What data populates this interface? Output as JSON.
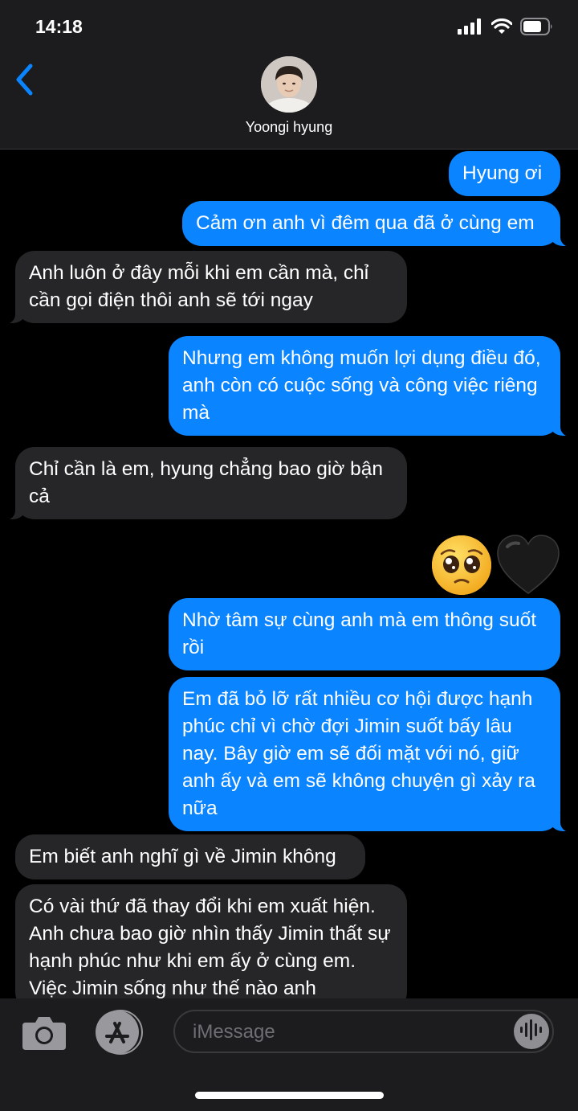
{
  "status_bar": {
    "time": "14:18"
  },
  "header": {
    "contact_name": "Yoongi hyung"
  },
  "messages": [
    {
      "sender": "me",
      "text": "Hyung ơi"
    },
    {
      "sender": "me",
      "text": "Cảm ơn anh vì đêm qua đã ở cùng em"
    },
    {
      "sender": "other",
      "text": "Anh luôn ở đây mỗi khi em cần mà, chỉ cần gọi điện thôi anh sẽ tới ngay"
    },
    {
      "sender": "me",
      "text": "Nhưng em không muốn lợi dụng điều đó, anh còn có cuộc sống và công việc riêng mà"
    },
    {
      "sender": "other",
      "text": "Chỉ cần là em, hyung chẳng bao giờ bận cả"
    },
    {
      "sender": "me",
      "text": "Nhờ tâm sự cùng anh mà em thông suốt rồi"
    },
    {
      "sender": "me",
      "text": "Em đã bỏ lỡ rất nhiều cơ hội được hạnh phúc chỉ vì chờ đợi Jimin suốt bấy lâu nay. Bây giờ em sẽ đối mặt với nó, giữ anh ấy và em sẽ không chuyện gì xảy ra nữa"
    },
    {
      "sender": "other",
      "text": "Em biết anh nghĩ gì về Jimin không"
    },
    {
      "sender": "other",
      "text": "Có vài thứ đã thay đổi khi em xuất hiện. Anh chưa bao giờ nhìn thấy Jimin thất sự hạnh phúc như khi em ấy ở cùng em. Việc Jimin sống như thế nào anh"
    }
  ],
  "emoji_message": {
    "sender": "me",
    "emojis": [
      "pleading-face",
      "black-heart"
    ]
  },
  "input": {
    "placeholder": "iMessage"
  },
  "colors": {
    "sent_bubble": "#0a84ff",
    "received_bubble": "#262628",
    "accent": "#0a84ff",
    "background": "#000000",
    "bar_background": "#1c1c1e"
  }
}
